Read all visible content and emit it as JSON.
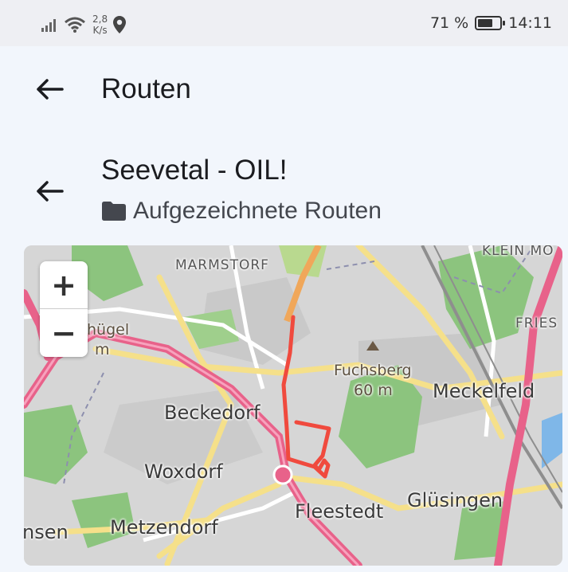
{
  "status_bar": {
    "network_speed_value": "2,8",
    "network_speed_unit": "K/s",
    "battery_percent_text": "71 %",
    "battery_level": 0.71,
    "time": "14:11",
    "icons": [
      "signal-icon",
      "wifi-icon",
      "location-icon",
      "battery-icon"
    ]
  },
  "app_bar": {
    "title": "Routen",
    "back_icon": "arrow-left-icon"
  },
  "route": {
    "title": "Seevetal - OIL!",
    "folder_icon": "folder-icon",
    "folder_name": "Aufgezeichnete Routen"
  },
  "map": {
    "zoom_in_label": "+",
    "zoom_out_label": "−",
    "labels": {
      "marmstorf": "MARMSTORF",
      "klein_mo": "KLEIN MO",
      "fries": "FRIES",
      "huegel": "hügel",
      "huegel_height": "m",
      "fuchsberg": "Fuchsberg",
      "fuchsberg_height": "60 m",
      "meckelfeld": "Meckelfeld",
      "beckedorf": "Beckedorf",
      "woxdorf": "Woxdorf",
      "fleestedt": "Fleestedt",
      "gluesingen": "Glüsingen",
      "metzendorf": "Metzendorf",
      "nsen": "nsen"
    },
    "route_color": "#f04a3e"
  },
  "colors": {
    "background": "#f2f6fc",
    "status_bar": "#eeeff3",
    "forest": "#8cc47e",
    "motorway": "#e8628a"
  }
}
